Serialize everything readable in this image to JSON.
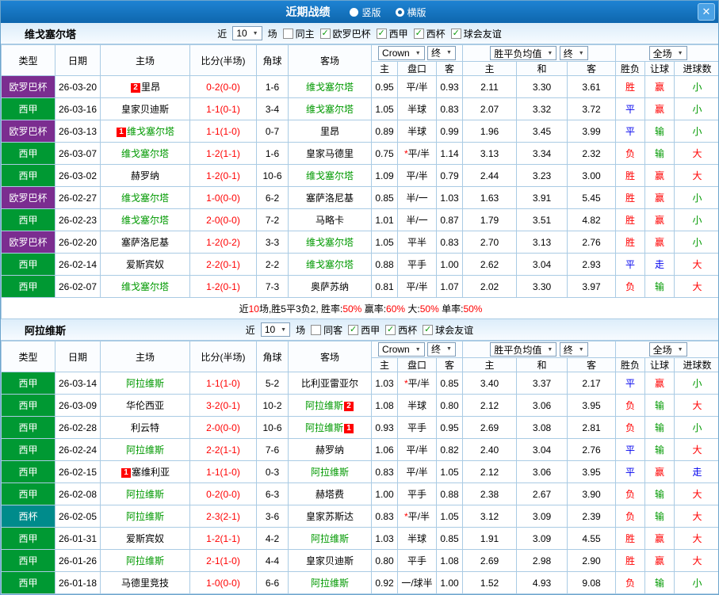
{
  "topbar": {
    "title": "近期战绩",
    "options": [
      {
        "label": "竖版",
        "selected": false
      },
      {
        "label": "横版",
        "selected": true
      }
    ],
    "close_icon": "✕"
  },
  "colors": {
    "accent_blue": "#0e66ad",
    "europa_purple": "#7b2d90",
    "liga_green": "#009933",
    "cup_teal": "#008b8b",
    "win_red": "#ff0000",
    "draw_blue": "#0000ee",
    "lose_green": "#009900"
  },
  "table_header": {
    "col_type": "类型",
    "col_date": "日期",
    "col_home": "主场",
    "col_score": "比分(半场)",
    "col_corner": "角球",
    "col_away": "客场",
    "dd_bookmaker": "Crown",
    "dd_final1": "终",
    "dd_avg": "胜平负均值",
    "dd_final2": "终",
    "dd_fulltime": "全场",
    "sub_home": "主",
    "sub_line": "盘口",
    "sub_away": "客",
    "sub_ehome": "主",
    "sub_draw": "和",
    "sub_eaway": "客",
    "sub_result": "胜负",
    "sub_handicap": "让球",
    "sub_goals": "进球数"
  },
  "sections": [
    {
      "team": "维戈塞尔塔",
      "filter": {
        "prefix": "近",
        "count": "10",
        "suffix": "场",
        "checks": [
          {
            "label": "同主",
            "checked": false
          },
          {
            "label": "欧罗巴杯",
            "checked": true
          },
          {
            "label": "西甲",
            "checked": true
          },
          {
            "label": "西杯",
            "checked": true
          },
          {
            "label": "球会友谊",
            "checked": true
          }
        ]
      },
      "summary": [
        {
          "t": "近",
          "c": "k"
        },
        {
          "t": "10",
          "c": "r"
        },
        {
          "t": "场,胜5平3负2,  胜率:",
          "c": "k"
        },
        {
          "t": "50%",
          "c": "r"
        },
        {
          "t": " 赢率:",
          "c": "k"
        },
        {
          "t": "60%",
          "c": "r"
        },
        {
          "t": " 大:",
          "c": "k"
        },
        {
          "t": "50%",
          "c": "r"
        },
        {
          "t": " 单率:",
          "c": "k"
        },
        {
          "t": "50%",
          "c": "r"
        }
      ],
      "rows": [
        {
          "league": "欧罗巴杯",
          "lt": "europa",
          "date": "26-03-20",
          "hb": "2",
          "home": "里昂",
          "hf": false,
          "score": "0-2(0-0)",
          "corner": "1-6",
          "ab": null,
          "away": "维戈塞尔塔",
          "af": true,
          "ah": "0.95",
          "star": false,
          "line": "平/半",
          "aa": "0.93",
          "eh": "2.11",
          "ed": "3.30",
          "ea": "3.61",
          "res": "胜",
          "resc": "r",
          "hcp": "赢",
          "hcpc": "r",
          "goal": "小",
          "goalc": "g"
        },
        {
          "league": "西甲",
          "lt": "liga",
          "date": "26-03-16",
          "hb": null,
          "home": "皇家贝迪斯",
          "hf": false,
          "score": "1-1(0-1)",
          "corner": "3-4",
          "ab": null,
          "away": "维戈塞尔塔",
          "af": true,
          "ah": "1.05",
          "star": false,
          "line": "半球",
          "aa": "0.83",
          "eh": "2.07",
          "ed": "3.32",
          "ea": "3.72",
          "res": "平",
          "resc": "b",
          "hcp": "赢",
          "hcpc": "r",
          "goal": "小",
          "goalc": "g"
        },
        {
          "league": "欧罗巴杯",
          "lt": "europa",
          "date": "26-03-13",
          "hb": "1",
          "home": "维戈塞尔塔",
          "hf": true,
          "score": "1-1(1-0)",
          "corner": "0-7",
          "ab": null,
          "away": "里昂",
          "af": false,
          "ah": "0.89",
          "star": false,
          "line": "半球",
          "aa": "0.99",
          "eh": "1.96",
          "ed": "3.45",
          "ea": "3.99",
          "res": "平",
          "resc": "b",
          "hcp": "输",
          "hcpc": "g",
          "goal": "小",
          "goalc": "g"
        },
        {
          "league": "西甲",
          "lt": "liga",
          "date": "26-03-07",
          "hb": null,
          "home": "维戈塞尔塔",
          "hf": true,
          "score": "1-2(1-1)",
          "corner": "1-6",
          "ab": null,
          "away": "皇家马德里",
          "af": false,
          "ah": "0.75",
          "star": true,
          "line": "平/半",
          "aa": "1.14",
          "eh": "3.13",
          "ed": "3.34",
          "ea": "2.32",
          "res": "负",
          "resc": "r",
          "hcp": "输",
          "hcpc": "g",
          "goal": "大",
          "goalc": "r"
        },
        {
          "league": "西甲",
          "lt": "liga",
          "date": "26-03-02",
          "hb": null,
          "home": "赫罗纳",
          "hf": false,
          "score": "1-2(0-1)",
          "corner": "10-6",
          "ab": null,
          "away": "维戈塞尔塔",
          "af": true,
          "ah": "1.09",
          "star": false,
          "line": "平/半",
          "aa": "0.79",
          "eh": "2.44",
          "ed": "3.23",
          "ea": "3.00",
          "res": "胜",
          "resc": "r",
          "hcp": "赢",
          "hcpc": "r",
          "goal": "大",
          "goalc": "r"
        },
        {
          "league": "欧罗巴杯",
          "lt": "europa",
          "date": "26-02-27",
          "hb": null,
          "home": "维戈塞尔塔",
          "hf": true,
          "score": "1-0(0-0)",
          "corner": "6-2",
          "ab": null,
          "away": "塞萨洛尼基",
          "af": false,
          "ah": "0.85",
          "star": false,
          "line": "半/一",
          "aa": "1.03",
          "eh": "1.63",
          "ed": "3.91",
          "ea": "5.45",
          "res": "胜",
          "resc": "r",
          "hcp": "赢",
          "hcpc": "r",
          "goal": "小",
          "goalc": "g"
        },
        {
          "league": "西甲",
          "lt": "liga",
          "date": "26-02-23",
          "hb": null,
          "home": "维戈塞尔塔",
          "hf": true,
          "score": "2-0(0-0)",
          "corner": "7-2",
          "ab": null,
          "away": "马略卡",
          "af": false,
          "ah": "1.01",
          "star": false,
          "line": "半/一",
          "aa": "0.87",
          "eh": "1.79",
          "ed": "3.51",
          "ea": "4.82",
          "res": "胜",
          "resc": "r",
          "hcp": "赢",
          "hcpc": "r",
          "goal": "小",
          "goalc": "g"
        },
        {
          "league": "欧罗巴杯",
          "lt": "europa",
          "date": "26-02-20",
          "hb": null,
          "home": "塞萨洛尼基",
          "hf": false,
          "score": "1-2(0-2)",
          "corner": "3-3",
          "ab": null,
          "away": "维戈塞尔塔",
          "af": true,
          "ah": "1.05",
          "star": false,
          "line": "平半",
          "aa": "0.83",
          "eh": "2.70",
          "ed": "3.13",
          "ea": "2.76",
          "res": "胜",
          "resc": "r",
          "hcp": "赢",
          "hcpc": "r",
          "goal": "小",
          "goalc": "g"
        },
        {
          "league": "西甲",
          "lt": "liga",
          "date": "26-02-14",
          "hb": null,
          "home": "爱斯宾奴",
          "hf": false,
          "score": "2-2(0-1)",
          "corner": "2-2",
          "ab": null,
          "away": "维戈塞尔塔",
          "af": true,
          "ah": "0.88",
          "star": false,
          "line": "平手",
          "aa": "1.00",
          "eh": "2.62",
          "ed": "3.04",
          "ea": "2.93",
          "res": "平",
          "resc": "b",
          "hcp": "走",
          "hcpc": "b",
          "goal": "大",
          "goalc": "r"
        },
        {
          "league": "西甲",
          "lt": "liga",
          "date": "26-02-07",
          "hb": null,
          "home": "维戈塞尔塔",
          "hf": true,
          "score": "1-2(0-1)",
          "corner": "7-3",
          "ab": null,
          "away": "奥萨苏纳",
          "af": false,
          "ah": "0.81",
          "star": false,
          "line": "平/半",
          "aa": "1.07",
          "eh": "2.02",
          "ed": "3.30",
          "ea": "3.97",
          "res": "负",
          "resc": "r",
          "hcp": "输",
          "hcpc": "g",
          "goal": "大",
          "goalc": "r"
        }
      ]
    },
    {
      "team": "阿拉维斯",
      "filter": {
        "prefix": "近",
        "count": "10",
        "suffix": "场",
        "checks": [
          {
            "label": "同客",
            "checked": false
          },
          {
            "label": "西甲",
            "checked": true
          },
          {
            "label": "西杯",
            "checked": true
          },
          {
            "label": "球会友谊",
            "checked": true
          }
        ]
      },
      "summary": null,
      "rows": [
        {
          "league": "西甲",
          "lt": "liga",
          "date": "26-03-14",
          "hb": null,
          "home": "阿拉维斯",
          "hf": true,
          "score": "1-1(1-0)",
          "corner": "5-2",
          "ab": null,
          "away": "比利亚雷亚尔",
          "af": false,
          "ah": "1.03",
          "star": true,
          "line": "平/半",
          "aa": "0.85",
          "eh": "3.40",
          "ed": "3.37",
          "ea": "2.17",
          "res": "平",
          "resc": "b",
          "hcp": "赢",
          "hcpc": "r",
          "goal": "小",
          "goalc": "g"
        },
        {
          "league": "西甲",
          "lt": "liga",
          "date": "26-03-09",
          "hb": null,
          "home": "华伦西亚",
          "hf": false,
          "score": "3-2(0-1)",
          "corner": "10-2",
          "ab": "2",
          "away": "阿拉维斯",
          "af": true,
          "ah": "1.08",
          "star": false,
          "line": "半球",
          "aa": "0.80",
          "eh": "2.12",
          "ed": "3.06",
          "ea": "3.95",
          "res": "负",
          "resc": "r",
          "hcp": "输",
          "hcpc": "g",
          "goal": "大",
          "goalc": "r"
        },
        {
          "league": "西甲",
          "lt": "liga",
          "date": "26-02-28",
          "hb": null,
          "home": "利云特",
          "hf": false,
          "score": "2-0(0-0)",
          "corner": "10-6",
          "ab": "1",
          "away": "阿拉维斯",
          "af": true,
          "ah": "0.93",
          "star": false,
          "line": "平手",
          "aa": "0.95",
          "eh": "2.69",
          "ed": "3.08",
          "ea": "2.81",
          "res": "负",
          "resc": "r",
          "hcp": "输",
          "hcpc": "g",
          "goal": "小",
          "goalc": "g"
        },
        {
          "league": "西甲",
          "lt": "liga",
          "date": "26-02-24",
          "hb": null,
          "home": "阿拉维斯",
          "hf": true,
          "score": "2-2(1-1)",
          "corner": "7-6",
          "ab": null,
          "away": "赫罗纳",
          "af": false,
          "ah": "1.06",
          "star": false,
          "line": "平/半",
          "aa": "0.82",
          "eh": "2.40",
          "ed": "3.04",
          "ea": "2.76",
          "res": "平",
          "resc": "b",
          "hcp": "输",
          "hcpc": "g",
          "goal": "大",
          "goalc": "r"
        },
        {
          "league": "西甲",
          "lt": "liga",
          "date": "26-02-15",
          "hb": "1",
          "home": "塞维利亚",
          "hf": false,
          "score": "1-1(1-0)",
          "corner": "0-3",
          "ab": null,
          "away": "阿拉维斯",
          "af": true,
          "ah": "0.83",
          "star": false,
          "line": "平/半",
          "aa": "1.05",
          "eh": "2.12",
          "ed": "3.06",
          "ea": "3.95",
          "res": "平",
          "resc": "b",
          "hcp": "赢",
          "hcpc": "r",
          "goal": "走",
          "goalc": "b"
        },
        {
          "league": "西甲",
          "lt": "liga",
          "date": "26-02-08",
          "hb": null,
          "home": "阿拉维斯",
          "hf": true,
          "score": "0-2(0-0)",
          "corner": "6-3",
          "ab": null,
          "away": "赫塔费",
          "af": false,
          "ah": "1.00",
          "star": false,
          "line": "平手",
          "aa": "0.88",
          "eh": "2.38",
          "ed": "2.67",
          "ea": "3.90",
          "res": "负",
          "resc": "r",
          "hcp": "输",
          "hcpc": "g",
          "goal": "大",
          "goalc": "r"
        },
        {
          "league": "西杯",
          "lt": "cup",
          "date": "26-02-05",
          "hb": null,
          "home": "阿拉维斯",
          "hf": true,
          "score": "2-3(2-1)",
          "corner": "3-6",
          "ab": null,
          "away": "皇家苏斯达",
          "af": false,
          "ah": "0.83",
          "star": true,
          "line": "平/半",
          "aa": "1.05",
          "eh": "3.12",
          "ed": "3.09",
          "ea": "2.39",
          "res": "负",
          "resc": "r",
          "hcp": "输",
          "hcpc": "g",
          "goal": "大",
          "goalc": "r"
        },
        {
          "league": "西甲",
          "lt": "liga",
          "date": "26-01-31",
          "hb": null,
          "home": "爱斯宾奴",
          "hf": false,
          "score": "1-2(1-1)",
          "corner": "4-2",
          "ab": null,
          "away": "阿拉维斯",
          "af": true,
          "ah": "1.03",
          "star": false,
          "line": "半球",
          "aa": "0.85",
          "eh": "1.91",
          "ed": "3.09",
          "ea": "4.55",
          "res": "胜",
          "resc": "r",
          "hcp": "赢",
          "hcpc": "r",
          "goal": "大",
          "goalc": "r"
        },
        {
          "league": "西甲",
          "lt": "liga",
          "date": "26-01-26",
          "hb": null,
          "home": "阿拉维斯",
          "hf": true,
          "score": "2-1(1-0)",
          "corner": "4-4",
          "ab": null,
          "away": "皇家贝迪斯",
          "af": false,
          "ah": "0.80",
          "star": false,
          "line": "平手",
          "aa": "1.08",
          "eh": "2.69",
          "ed": "2.98",
          "ea": "2.90",
          "res": "胜",
          "resc": "r",
          "hcp": "赢",
          "hcpc": "r",
          "goal": "大",
          "goalc": "r"
        },
        {
          "league": "西甲",
          "lt": "liga",
          "date": "26-01-18",
          "hb": null,
          "home": "马德里竞技",
          "hf": false,
          "score": "1-0(0-0)",
          "corner": "6-6",
          "ab": null,
          "away": "阿拉维斯",
          "af": true,
          "ah": "0.92",
          "star": false,
          "line": "一/球半",
          "aa": "1.00",
          "eh": "1.52",
          "ed": "4.93",
          "ea": "9.08",
          "res": "负",
          "resc": "r",
          "hcp": "输",
          "hcpc": "g",
          "goal": "小",
          "goalc": "g"
        }
      ]
    }
  ]
}
